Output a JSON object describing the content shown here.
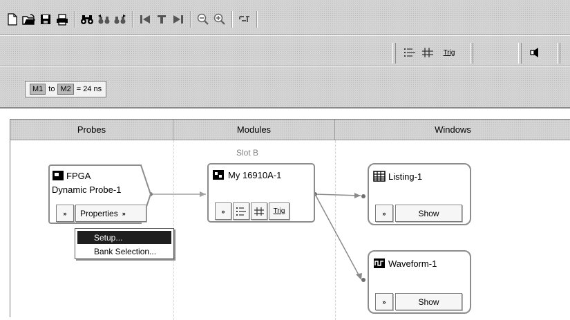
{
  "toolbar": {
    "icons": [
      "new-document-icon",
      "open-folder-icon",
      "save-icon",
      "print-icon",
      "find-icon",
      "find-previous-icon",
      "find-next-icon",
      "go-to-start-icon",
      "go-to-trigger-icon",
      "go-to-end-icon",
      "zoom-out-icon",
      "zoom-in-icon",
      "overview-icon"
    ]
  },
  "toolbar2": {
    "trig_label": "Trig"
  },
  "markers": {
    "m1": "M1",
    "to": "to",
    "m2": "M2",
    "value": "= 24 ns"
  },
  "columns": {
    "probes": "Probes",
    "modules": "Modules",
    "windows": "Windows"
  },
  "probe": {
    "name": "FPGA",
    "subtitle": "Dynamic Probe-1",
    "properties_label": "Properties"
  },
  "module": {
    "slot": "Slot B",
    "name": "My 16910A-1",
    "trig_label": "Trig"
  },
  "windows": {
    "listing": {
      "name": "Listing-1",
      "show_label": "Show"
    },
    "waveform": {
      "name": "Waveform-1",
      "show_label": "Show"
    }
  },
  "context_menu": {
    "items": [
      "Setup...",
      "Bank Selection..."
    ],
    "selected_index": 0
  }
}
